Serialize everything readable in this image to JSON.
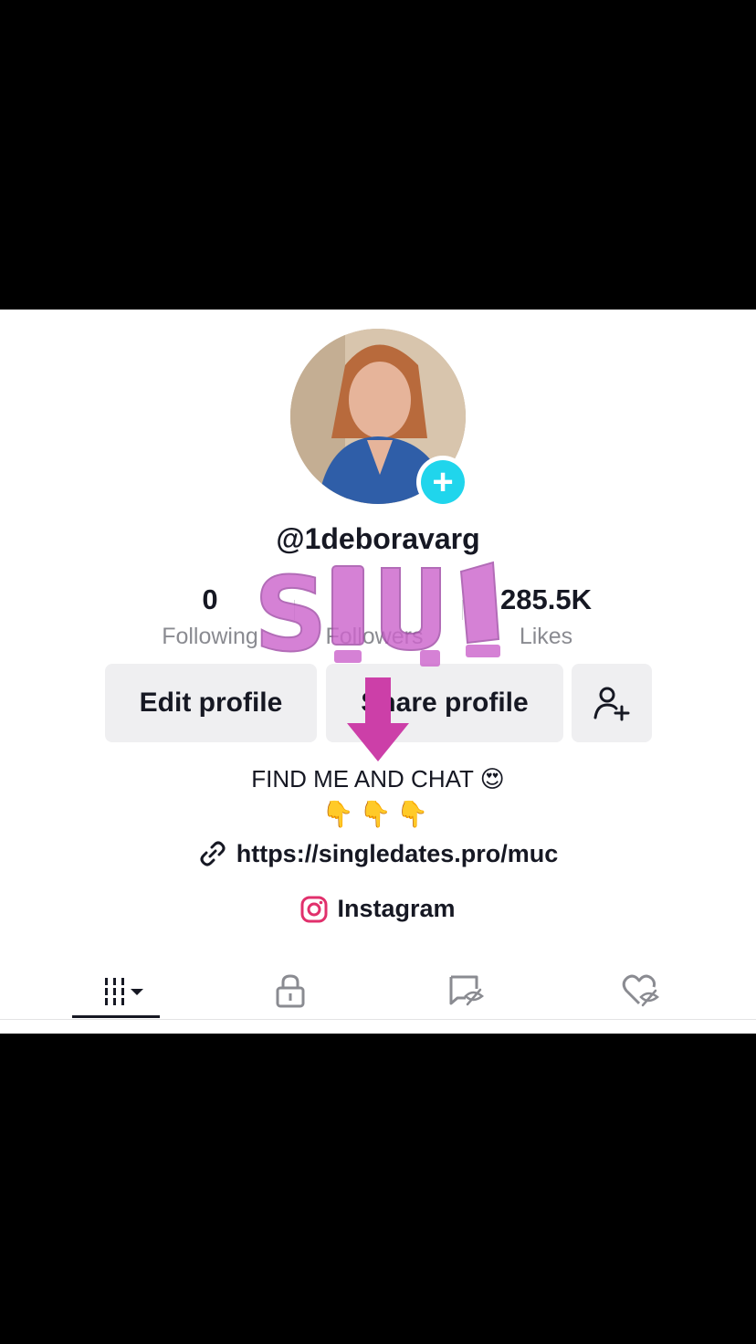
{
  "profile": {
    "username": "@1deboravarg",
    "add_badge": "+"
  },
  "stats": {
    "following_count": "0",
    "following_label": "Following",
    "followers_label": "Followers",
    "likes_count": "285.5K",
    "likes_label": "Likes"
  },
  "actions": {
    "edit_label": "Edit profile",
    "share_label": "Share profile"
  },
  "bio": {
    "line1": "FIND ME AND CHAT 😍",
    "line2": "👇👇👇"
  },
  "links": {
    "url": "https://singledates.pro/muc",
    "instagram_label": "Instagram"
  },
  "tabs": [
    {
      "name": "videos",
      "icon": "grid-icon",
      "active": true
    },
    {
      "name": "private",
      "icon": "lock-icon",
      "active": false
    },
    {
      "name": "reposts",
      "icon": "hidden-repost-icon",
      "active": false
    },
    {
      "name": "liked",
      "icon": "hidden-heart-icon",
      "active": false
    }
  ],
  "overlay": {
    "text": "SIUI",
    "color": "#cc66cc",
    "arrow_color": "#cc3fa8"
  },
  "colors": {
    "accent": "#20d5ec",
    "instagram": "#e1306c",
    "text": "#161823",
    "muted": "#8a8b91"
  }
}
